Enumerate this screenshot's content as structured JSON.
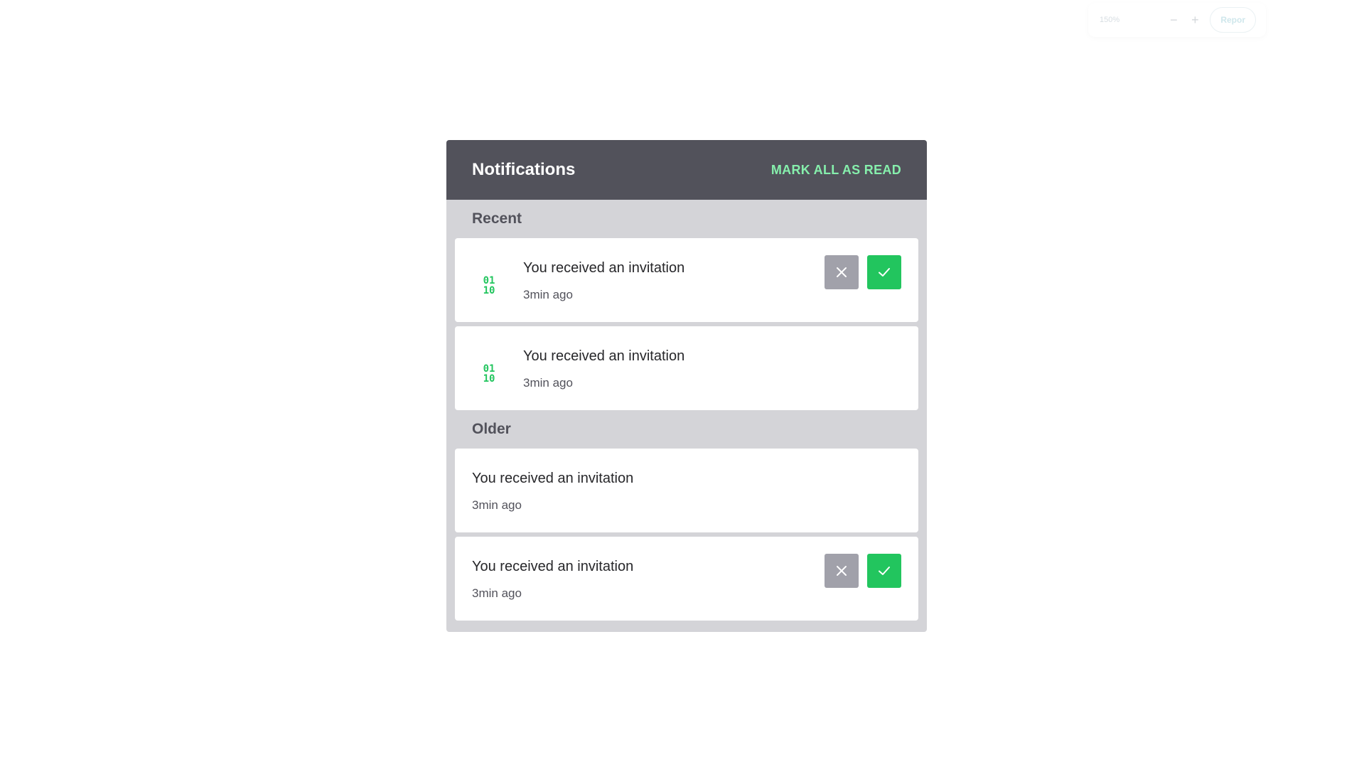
{
  "zoom_toolbar": {
    "zoom_level": "150%",
    "zoom_out_symbol": "−",
    "zoom_in_symbol": "+",
    "report_label": "Repor"
  },
  "panel": {
    "title": "Notifications",
    "mark_all_label": "MARK ALL AS READ",
    "colors": {
      "header": "#52525b",
      "background": "#d4d4d8",
      "accent": "#22c55e",
      "mark_all": "#86efac",
      "decline": "#a1a1aa"
    }
  },
  "sections": {
    "recent": {
      "label": "Recent",
      "items": [
        {
          "icon": "binary-icon",
          "message": "You received an invitation",
          "time": "3min ago",
          "has_actions": true
        },
        {
          "icon": "binary-icon",
          "message": "You received an invitation",
          "time": "3min ago",
          "has_actions": false
        }
      ]
    },
    "older": {
      "label": "Older",
      "items": [
        {
          "message": "You received an invitation",
          "time": "3min ago",
          "has_actions": false
        },
        {
          "message": "You received an invitation",
          "time": "3min ago",
          "has_actions": true
        }
      ]
    }
  }
}
